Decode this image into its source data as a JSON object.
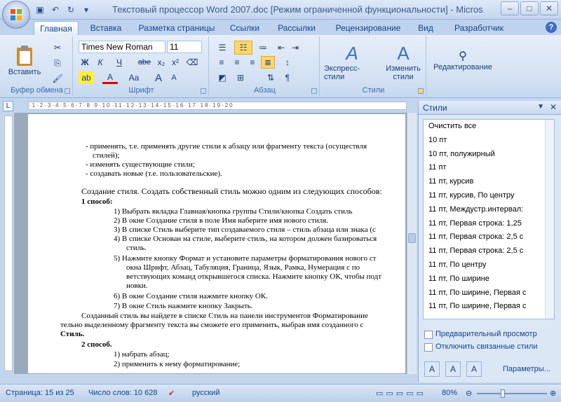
{
  "window": {
    "title": "Текстовый процессор Word 2007.doc [Режим ограниченной функциональности] - Micros..."
  },
  "tabs": [
    {
      "label": "Главная"
    },
    {
      "label": "Вставка"
    },
    {
      "label": "Разметка страницы"
    },
    {
      "label": "Ссылки"
    },
    {
      "label": "Рассылки"
    },
    {
      "label": "Рецензирование"
    },
    {
      "label": "Вид"
    },
    {
      "label": "Разработчик"
    }
  ],
  "ribbon": {
    "clipboard": {
      "paste_label": "Вставить",
      "group_label": "Буфер обмена"
    },
    "font": {
      "font_name": "Times New Roman",
      "font_size": "11",
      "group_label": "Шрифт",
      "bold": "Ж",
      "italic": "К",
      "underline": "Ч",
      "strike": "abe",
      "aa": "Aa",
      "grow": "A",
      "shrink": "A"
    },
    "paragraph": {
      "group_label": "Абзац"
    },
    "styles": {
      "express_label": "Экспресс-стили",
      "change_label": "Изменить стили",
      "group_label": "Стили"
    },
    "editing": {
      "label": "Редактирование"
    }
  },
  "ruler": {
    "corner": "L",
    "marks": "·1·2·3·4·5·6·7·8·9·10·11·12·13·14·15·16·17·18·19·20"
  },
  "document": {
    "lines": [
      "- применять, т.е. применять другие стили к абзацу или фрагменту текста (осуществля",
      "стилей);",
      "- изменять существующие стили;",
      "- создавать новые (т.е. пользовательские).",
      "Создание стиля. Создать собственный стиль можно одним из следующих способов:",
      "1 способ:",
      "1)   Выбрать вкладка Главная/кнопка группы Стили/кнопка Создать стиль",
      "2)   В окне Создание стиля в поле Имя наберите имя нового стиля.",
      "3)   В списке Стиль выберите тип создаваемого стиля – стиль абзаца или знака (с",
      "4)   В списке Основан на стиле, выберите стиль, на котором должен базироваться",
      "стиль.",
      "5)   Нажмите кнопку Формат и установите параметры форматирования нового ст",
      "окна Шрифт, Абзац, Табуляция, Граница, Язык, Рамка, Нумерация с по",
      "ветствующих команд открывшегося списка. Нажмите кнопку ОК, чтобы подт",
      "новки.",
      "6)   В окне Создание стиля нажмите кнопку ОК.",
      "7)   В окне Стиль нажмите кнопку Закрыть.",
      "Созданный стиль вы найдете в списке Стиль на панели инструментов Форматирование",
      "тельно выделенному фрагменту текста вы сможете его применить, выбрав имя созданного с",
      "Стиль.",
      "2 способ.",
      "1)   набрать абзац;",
      "2)   применить к нему форматирование;"
    ]
  },
  "styles_pane": {
    "title": "Стили",
    "items": [
      "Очистить все",
      "10 пт",
      "10 пт, полужирный",
      "11 пт",
      "11 пт, курсив",
      "11 пт, курсив, По центру",
      "11 пт, Междустр.интервал:",
      "11 пт, Первая строка:  1,25",
      "11 пт, Первая строка:  2,5 с",
      "11 пт, Первая строка:  2,5 с",
      "11 пт, По центру",
      "11 пт, По ширине",
      "11 пт, По ширине, Первая с",
      "11 пт, По ширине, Первая с"
    ],
    "preview_label": "Предварительный просмотр",
    "disable_linked_label": "Отключить связанные стили",
    "params_label": "Параметры..."
  },
  "status": {
    "page": "Страница: 15 из 25",
    "words": "Число слов: 10 628",
    "lang": "русский",
    "zoom": "80%"
  }
}
